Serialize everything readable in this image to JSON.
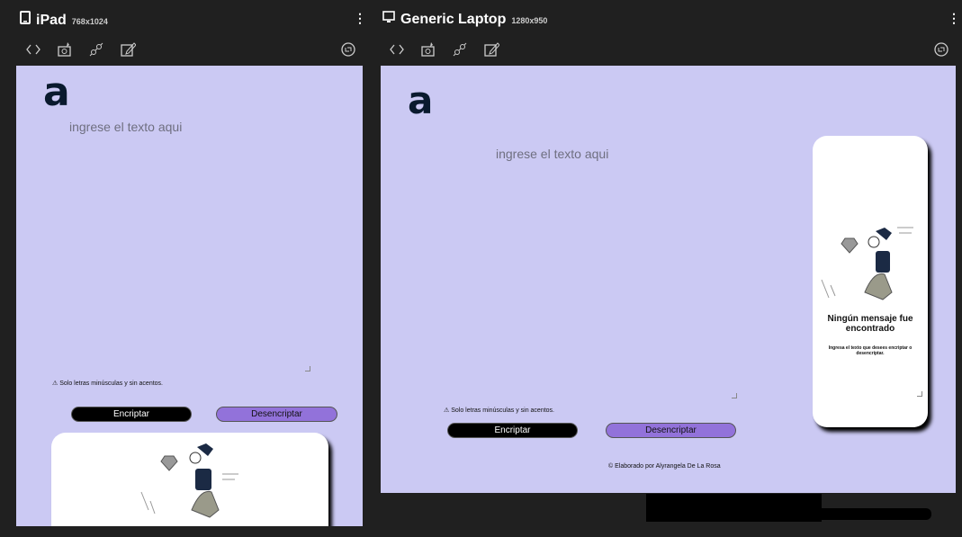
{
  "devices": [
    {
      "name": "iPad",
      "resolution": "768x1024",
      "icon": "tablet-icon"
    },
    {
      "name": "Generic Laptop",
      "resolution": "1280x950",
      "icon": "monitor-icon"
    }
  ],
  "toolbar": {
    "icons": [
      "code-icon",
      "screenshot-icon",
      "sync-icon",
      "edit-icon",
      "rotate-icon"
    ]
  },
  "app": {
    "logo": "a",
    "placeholder": "ingrese el texto aqui",
    "warning": "⚠ Solo letras minúsculas y sin acentos.",
    "encrypt_label": "Encriptar",
    "decrypt_label": "Desencriptar",
    "empty_title": "Ningún mensaje fue encontrado",
    "empty_subtitle": "Ingresa el texto que desees encriptar o desencriptar.",
    "footer": "© Elaborado por Alyrangela De La Rosa",
    "colors": {
      "background": "#cbc9f3",
      "encrypt": "#000000",
      "decrypt": "#9272da"
    }
  }
}
